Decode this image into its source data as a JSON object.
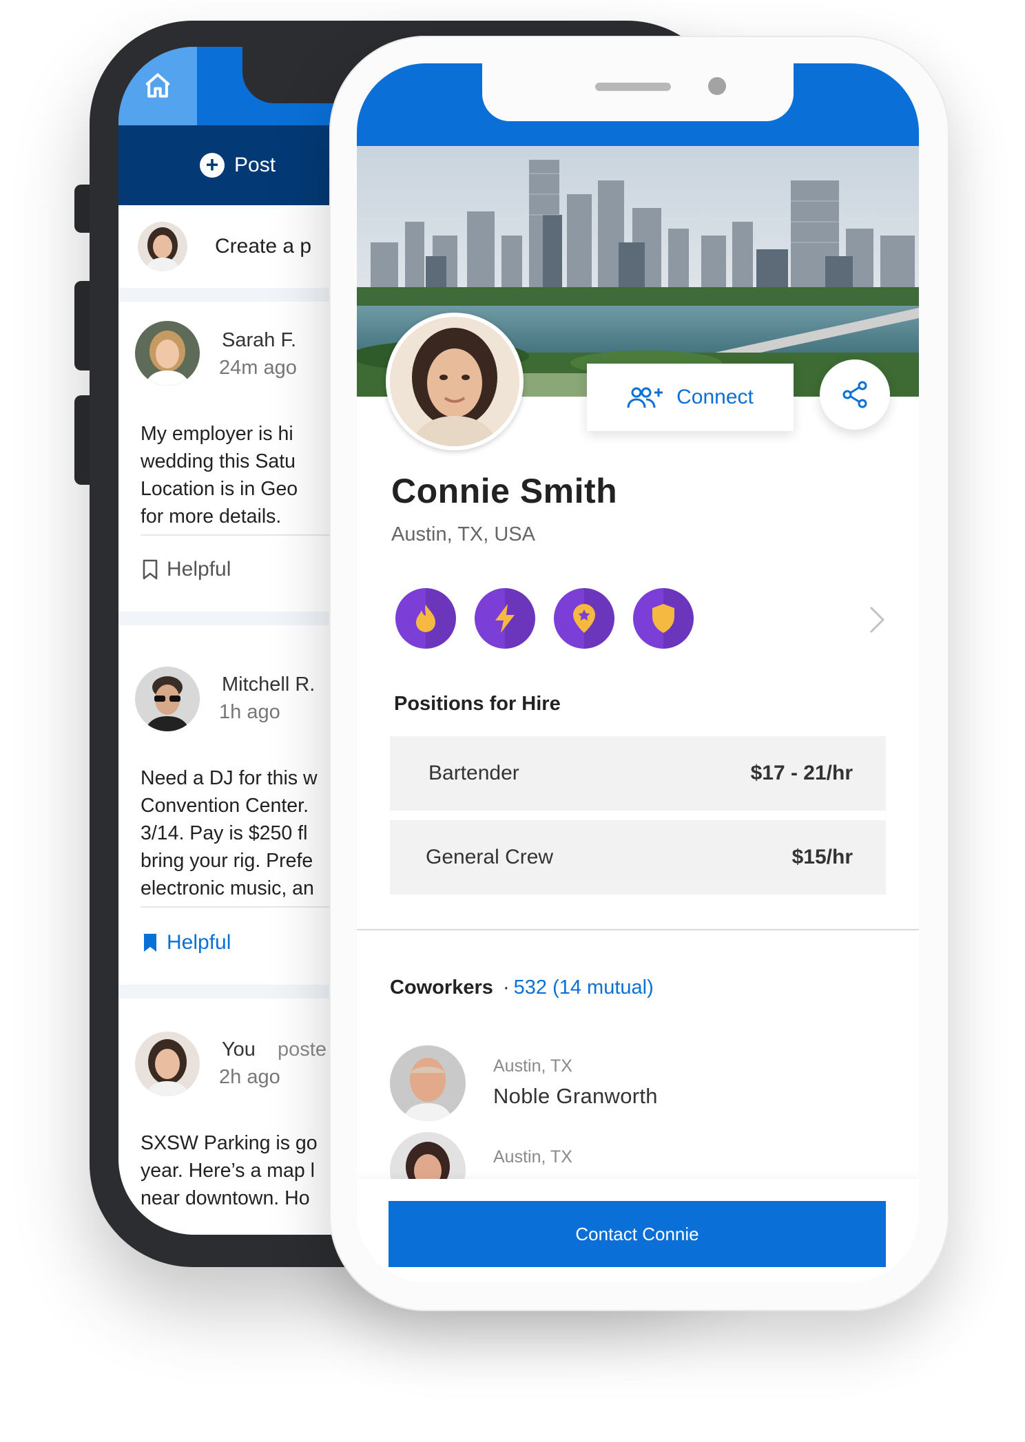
{
  "colors": {
    "primary": "#0a70d8",
    "navy": "#033a76",
    "badge": "#7b3fd8",
    "badge_icon": "#f5b941"
  },
  "back_app": {
    "post_button": "Post",
    "create_placeholder": "Create a p",
    "posts": [
      {
        "author": "Sarah F.",
        "time": "24m ago",
        "body": [
          "My employer is hi",
          "wedding this Satu",
          "Location is in Geo",
          "for more details."
        ],
        "helpful_label": "Helpful",
        "helpful_active": false
      },
      {
        "author": "Mitchell R.",
        "time": "1h ago",
        "body": [
          "Need a DJ for this w",
          "Convention Center.",
          "3/14. Pay is $250 fl",
          "bring your rig. Prefe",
          "electronic music, an"
        ],
        "helpful_label": "Helpful",
        "helpful_active": true
      },
      {
        "author": "You",
        "action": "poste",
        "time": "2h ago",
        "body": [
          "SXSW Parking is go",
          "year. Here’s a map l",
          "near downtown. Ho"
        ]
      }
    ]
  },
  "profile": {
    "connect_label": "Connect",
    "name": "Connie Smith",
    "location": "Austin, TX, USA",
    "badges": [
      "flame-badge-icon",
      "lightning-badge-icon",
      "star-pin-badge-icon",
      "shield-badge-icon"
    ],
    "positions_title": "Positions for Hire",
    "positions": [
      {
        "title": "Bartender",
        "rate": "$17 - 21/hr"
      },
      {
        "title": "General Crew",
        "rate": "$15/hr"
      }
    ],
    "coworkers_label": "Coworkers",
    "coworkers_separator": "·",
    "coworkers_count": "532 (14 mutual)",
    "coworkers": [
      {
        "location": "Austin, TX",
        "name": "Noble Granworth"
      },
      {
        "location": "Austin, TX",
        "name": ""
      }
    ],
    "contact_label": "Contact Connie"
  }
}
